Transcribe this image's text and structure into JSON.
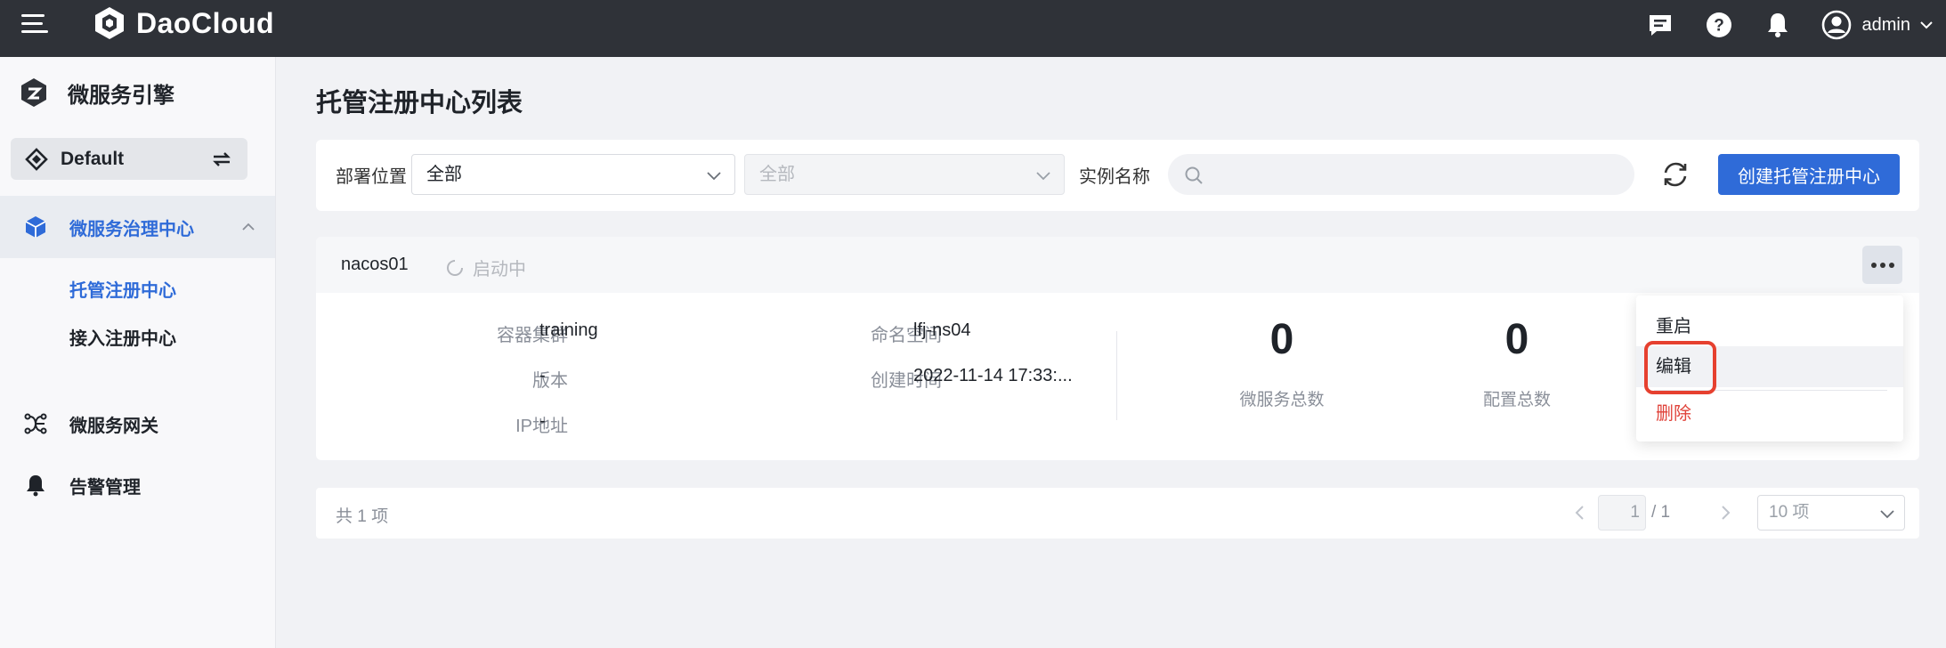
{
  "header": {
    "brand": "DaoCloud",
    "user": "admin",
    "icons": [
      "menu-icon",
      "message-icon",
      "help-icon",
      "bell-icon",
      "user-avatar-icon",
      "chevron-down-icon"
    ]
  },
  "sidebar": {
    "product": "微服务引擎",
    "workspace": "Default",
    "group": {
      "label": "微服务治理中心",
      "children": [
        "托管注册中心",
        "接入注册中心"
      ]
    },
    "items": [
      {
        "label": "微服务网关"
      },
      {
        "label": "告警管理"
      }
    ]
  },
  "main": {
    "title": "托管注册中心列表",
    "filters": {
      "location_label": "部署位置",
      "location_value": "全部",
      "sub_value": "全部",
      "instance_label": "实例名称",
      "search_value": ""
    },
    "create_button": "创建托管注册中心",
    "instance": {
      "name": "nacos01",
      "status": "启动中",
      "fields": [
        {
          "label": "容器集群",
          "value": "training"
        },
        {
          "label": "版本",
          "value": "-"
        },
        {
          "label": "IP地址",
          "value": "-"
        },
        {
          "label": "命名空间",
          "value": "lfj-ns04"
        },
        {
          "label": "创建时间",
          "value": "2022-11-14 17:33:..."
        }
      ],
      "stats": [
        {
          "value": "0",
          "label": "微服务总数"
        },
        {
          "value": "0",
          "label": "配置总数"
        }
      ]
    },
    "menu": [
      {
        "label": "重启"
      },
      {
        "label": "编辑"
      },
      {
        "label": "删除"
      }
    ],
    "pagination": {
      "total": "共 1 项",
      "current": "1",
      "of": "/ 1",
      "page_size": "10 项"
    }
  },
  "colors": {
    "topbar": "#2f3238",
    "primary": "#2f6bd8",
    "danger": "#e0433a",
    "highlight": "#e6402f"
  }
}
